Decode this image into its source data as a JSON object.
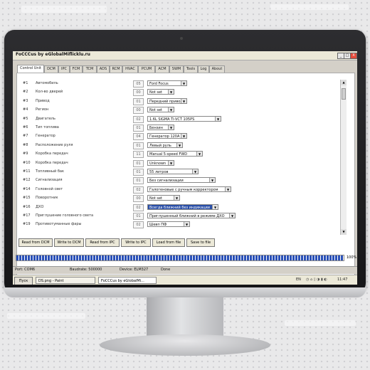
{
  "window": {
    "title": "FoCCCus by eGlobalMiflicklu.ru",
    "btn_min": "_",
    "btn_max": "□",
    "btn_close": "X"
  },
  "tabs": [
    "Control Unit",
    "DCM",
    "IPC",
    "FCM",
    "TCM",
    "ADS",
    "RCM",
    "HVAC",
    "PCUM",
    "ACM",
    "SWM",
    "Tools",
    "Log",
    "About"
  ],
  "rows": [
    {
      "num": "#1",
      "label": "Автомобиль",
      "code": "05",
      "value": "Ford Focus",
      "highlight": false
    },
    {
      "num": "#2",
      "label": "Кол-во дверей",
      "code": "00",
      "value": "Not set",
      "highlight": false
    },
    {
      "num": "#3",
      "label": "Привод",
      "code": "01",
      "value": "Передний привод",
      "highlight": false
    },
    {
      "num": "#4",
      "label": "Регион",
      "code": "00",
      "value": "Not set",
      "highlight": false
    },
    {
      "num": "#5",
      "label": "Двигатель",
      "code": "02",
      "value": "1.6L SIGMA Ti-VCT 105PS",
      "highlight": false
    },
    {
      "num": "#6",
      "label": "Тип топлива",
      "code": "01",
      "value": "Бензин",
      "highlight": false
    },
    {
      "num": "#7",
      "label": "Генератор",
      "code": "04",
      "value": "Генератор 120А",
      "highlight": false
    },
    {
      "num": "#8",
      "label": "Расположение руля",
      "code": "01",
      "value": "Левый руль",
      "highlight": false
    },
    {
      "num": "#9",
      "label": "Коробка передач",
      "code": "11",
      "value": "Manual 5-speed FWD",
      "highlight": false
    },
    {
      "num": "#10",
      "label": "Коробка передач",
      "code": "01",
      "value": "Unknown",
      "highlight": false
    },
    {
      "num": "#11",
      "label": "Топливный бак",
      "code": "01",
      "value": "55 литров",
      "highlight": false
    },
    {
      "num": "#12",
      "label": "Сигнализация",
      "code": "01",
      "value": "Без сигнализации",
      "highlight": false
    },
    {
      "num": "#14",
      "label": "Головной свет",
      "code": "02",
      "value": "Галогеновые с ручным корректором",
      "highlight": false
    },
    {
      "num": "#15",
      "label": "Поворотник",
      "code": "00",
      "value": "Not set",
      "highlight": false
    },
    {
      "num": "#16",
      "label": "ДХО",
      "code": "02",
      "value": "Всегда ближний без индикации",
      "highlight": true
    },
    {
      "num": "#17",
      "label": "Приглушение головного света",
      "code": "01",
      "value": "Приглушенный ближний в режиме ДХО",
      "highlight": false
    },
    {
      "num": "#19",
      "label": "Противотуманные фары",
      "code": "02",
      "value": "Шевп ПФ",
      "highlight": false
    }
  ],
  "buttons": [
    "Read from DCM",
    "Write to DCM",
    "Read from IPC",
    "Write to IPC",
    "Load from file",
    "Save to file"
  ],
  "progress": {
    "fraction": 1.0,
    "label": "100%"
  },
  "status": {
    "port": "Port: COM6",
    "baud": "Baudrate: 500000",
    "device": "Device: ELM327",
    "state": "Done"
  },
  "taskbar": {
    "start": "Пуск",
    "tasks": [
      "DS.png - Paint",
      "FoCCCus by eGlobalMi..."
    ],
    "tray": "EN",
    "clock": "11:47"
  },
  "colors": {
    "accent": "#2950b8",
    "highlight": "#2a4fa8"
  }
}
